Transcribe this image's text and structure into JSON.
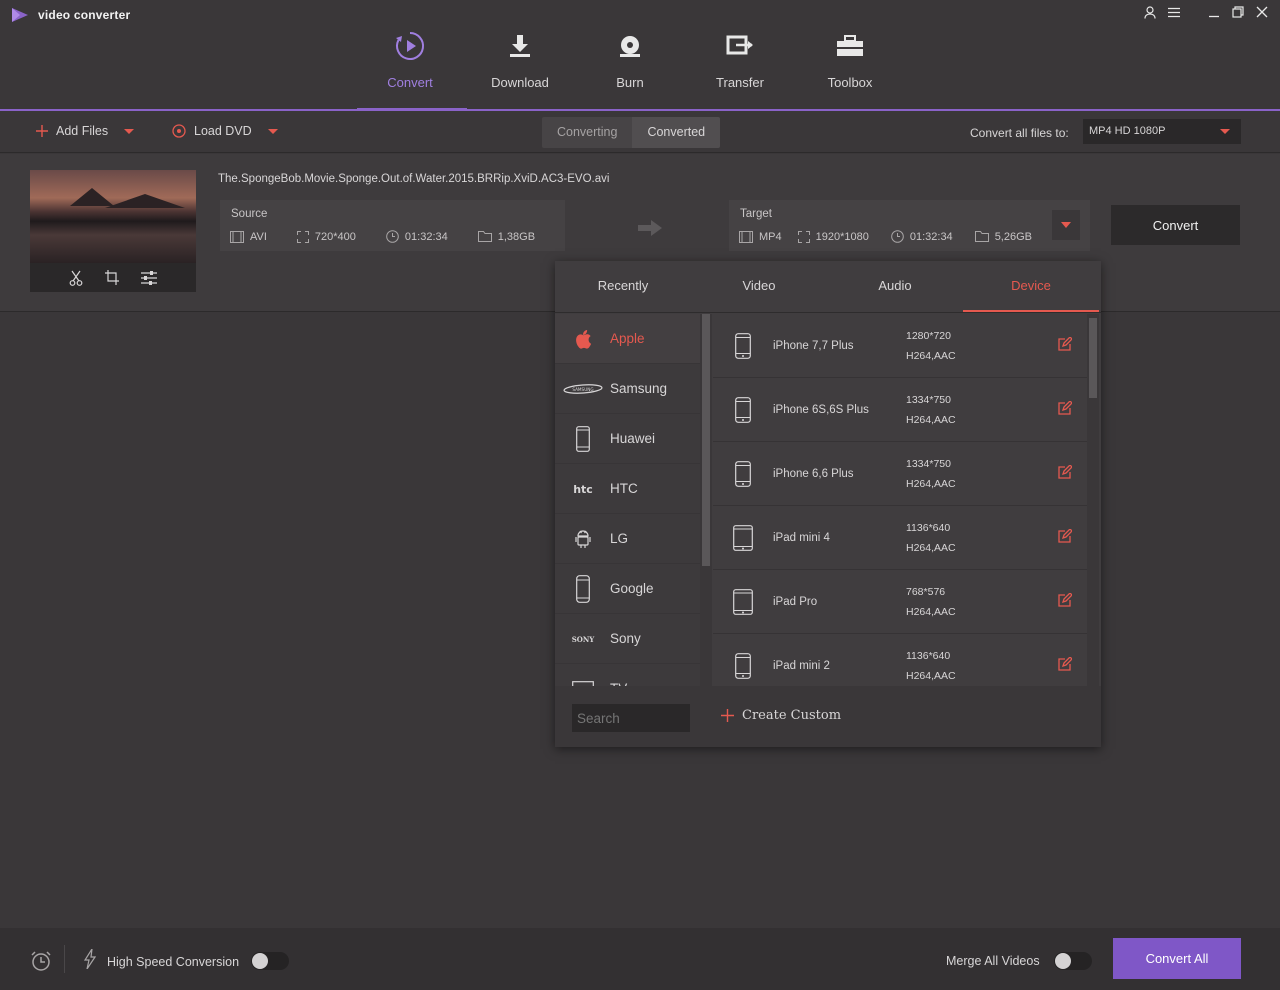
{
  "app": {
    "title": "video converter"
  },
  "nav": {
    "items": [
      {
        "label": "Convert",
        "icon": "convert-icon",
        "active": true
      },
      {
        "label": "Download",
        "icon": "download-icon"
      },
      {
        "label": "Burn",
        "icon": "burn-icon"
      },
      {
        "label": "Transfer",
        "icon": "transfer-icon"
      },
      {
        "label": "Toolbox",
        "icon": "toolbox-icon"
      }
    ]
  },
  "toolbar": {
    "add_files": "Add Files",
    "load_dvd": "Load DVD",
    "tab_converting": "Converting",
    "tab_converted": "Converted",
    "convert_all_to_label": "Convert all files to:",
    "convert_all_to_value": "MP4 HD 1080P"
  },
  "file": {
    "name": "The.SpongeBob.Movie.Sponge.Out.of.Water.2015.BRRip.XviD.AC3-EVO.avi",
    "source": {
      "label": "Source",
      "format": "AVI",
      "resolution": "720*400",
      "duration": "01:32:34",
      "size": "1,38GB"
    },
    "target": {
      "label": "Target",
      "format": "MP4",
      "resolution": "1920*1080",
      "duration": "01:32:34",
      "size": "5,26GB"
    },
    "convert_label": "Convert"
  },
  "format_popup": {
    "tabs": [
      "Recently",
      "Video",
      "Audio",
      "Device"
    ],
    "active_tab": "Device",
    "brands": [
      {
        "label": "Apple",
        "icon": "apple-icon"
      },
      {
        "label": "Samsung",
        "icon": "samsung-logo-icon"
      },
      {
        "label": "Huawei",
        "icon": "phone-icon"
      },
      {
        "label": "HTC",
        "icon": "htc-logo-icon"
      },
      {
        "label": "LG",
        "icon": "android-icon"
      },
      {
        "label": "Google",
        "icon": "phone-icon"
      },
      {
        "label": "Sony",
        "icon": "sony-logo-icon"
      },
      {
        "label": "TV",
        "icon": "tv-icon"
      }
    ],
    "devices": [
      {
        "name": "iPhone 7,7 Plus",
        "resolution": "1280*720",
        "codec": "H264,AAC"
      },
      {
        "name": "iPhone 6S,6S Plus",
        "resolution": "1334*750",
        "codec": "H264,AAC"
      },
      {
        "name": "iPhone 6,6 Plus",
        "resolution": "1334*750",
        "codec": "H264,AAC"
      },
      {
        "name": "iPad mini 4",
        "resolution": "1136*640",
        "codec": "H264,AAC"
      },
      {
        "name": "iPad Pro",
        "resolution": "768*576",
        "codec": "H264,AAC"
      },
      {
        "name": "iPad mini 2",
        "resolution": "1136*640",
        "codec": "H264,AAC"
      }
    ],
    "search_placeholder": "Search",
    "create_custom": "Create Custom"
  },
  "bottom": {
    "high_speed": "High Speed Conversion",
    "merge_all": "Merge All Videos",
    "convert_all": "Convert All"
  },
  "colors": {
    "accent_purple": "#8a63c9",
    "accent_red": "#e5594f",
    "background": "#3a3739"
  }
}
